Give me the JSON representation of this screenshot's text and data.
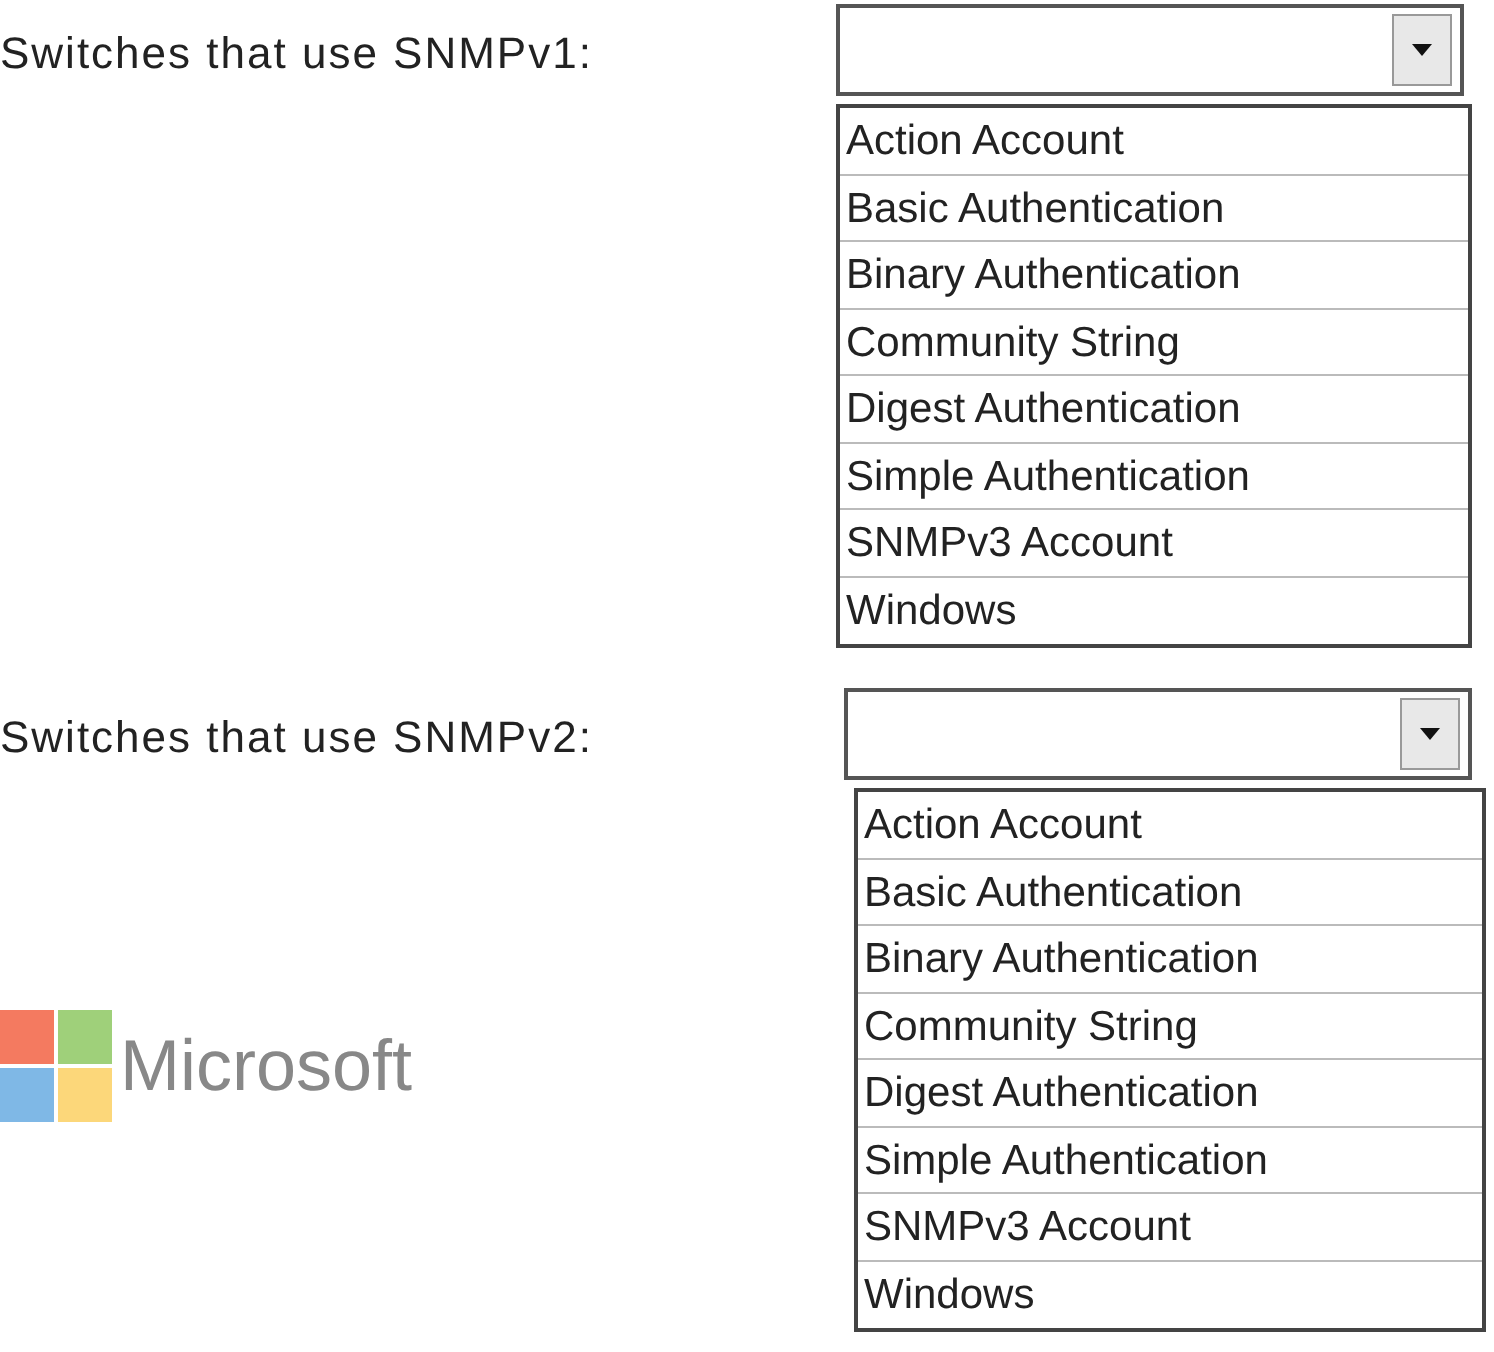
{
  "questions": [
    {
      "label": "Switches that use SNMPv1:",
      "options": [
        "Action Account",
        "Basic Authentication",
        "Binary Authentication",
        "Community String",
        "Digest Authentication",
        "Simple Authentication",
        "SNMPv3 Account",
        "Windows"
      ]
    },
    {
      "label": "Switches that use SNMPv2:",
      "options": [
        "Action Account",
        "Basic Authentication",
        "Binary Authentication",
        "Community String",
        "Digest Authentication",
        "Simple Authentication",
        "SNMPv3 Account",
        "Windows"
      ]
    }
  ],
  "logo": {
    "text": "Microsoft"
  }
}
